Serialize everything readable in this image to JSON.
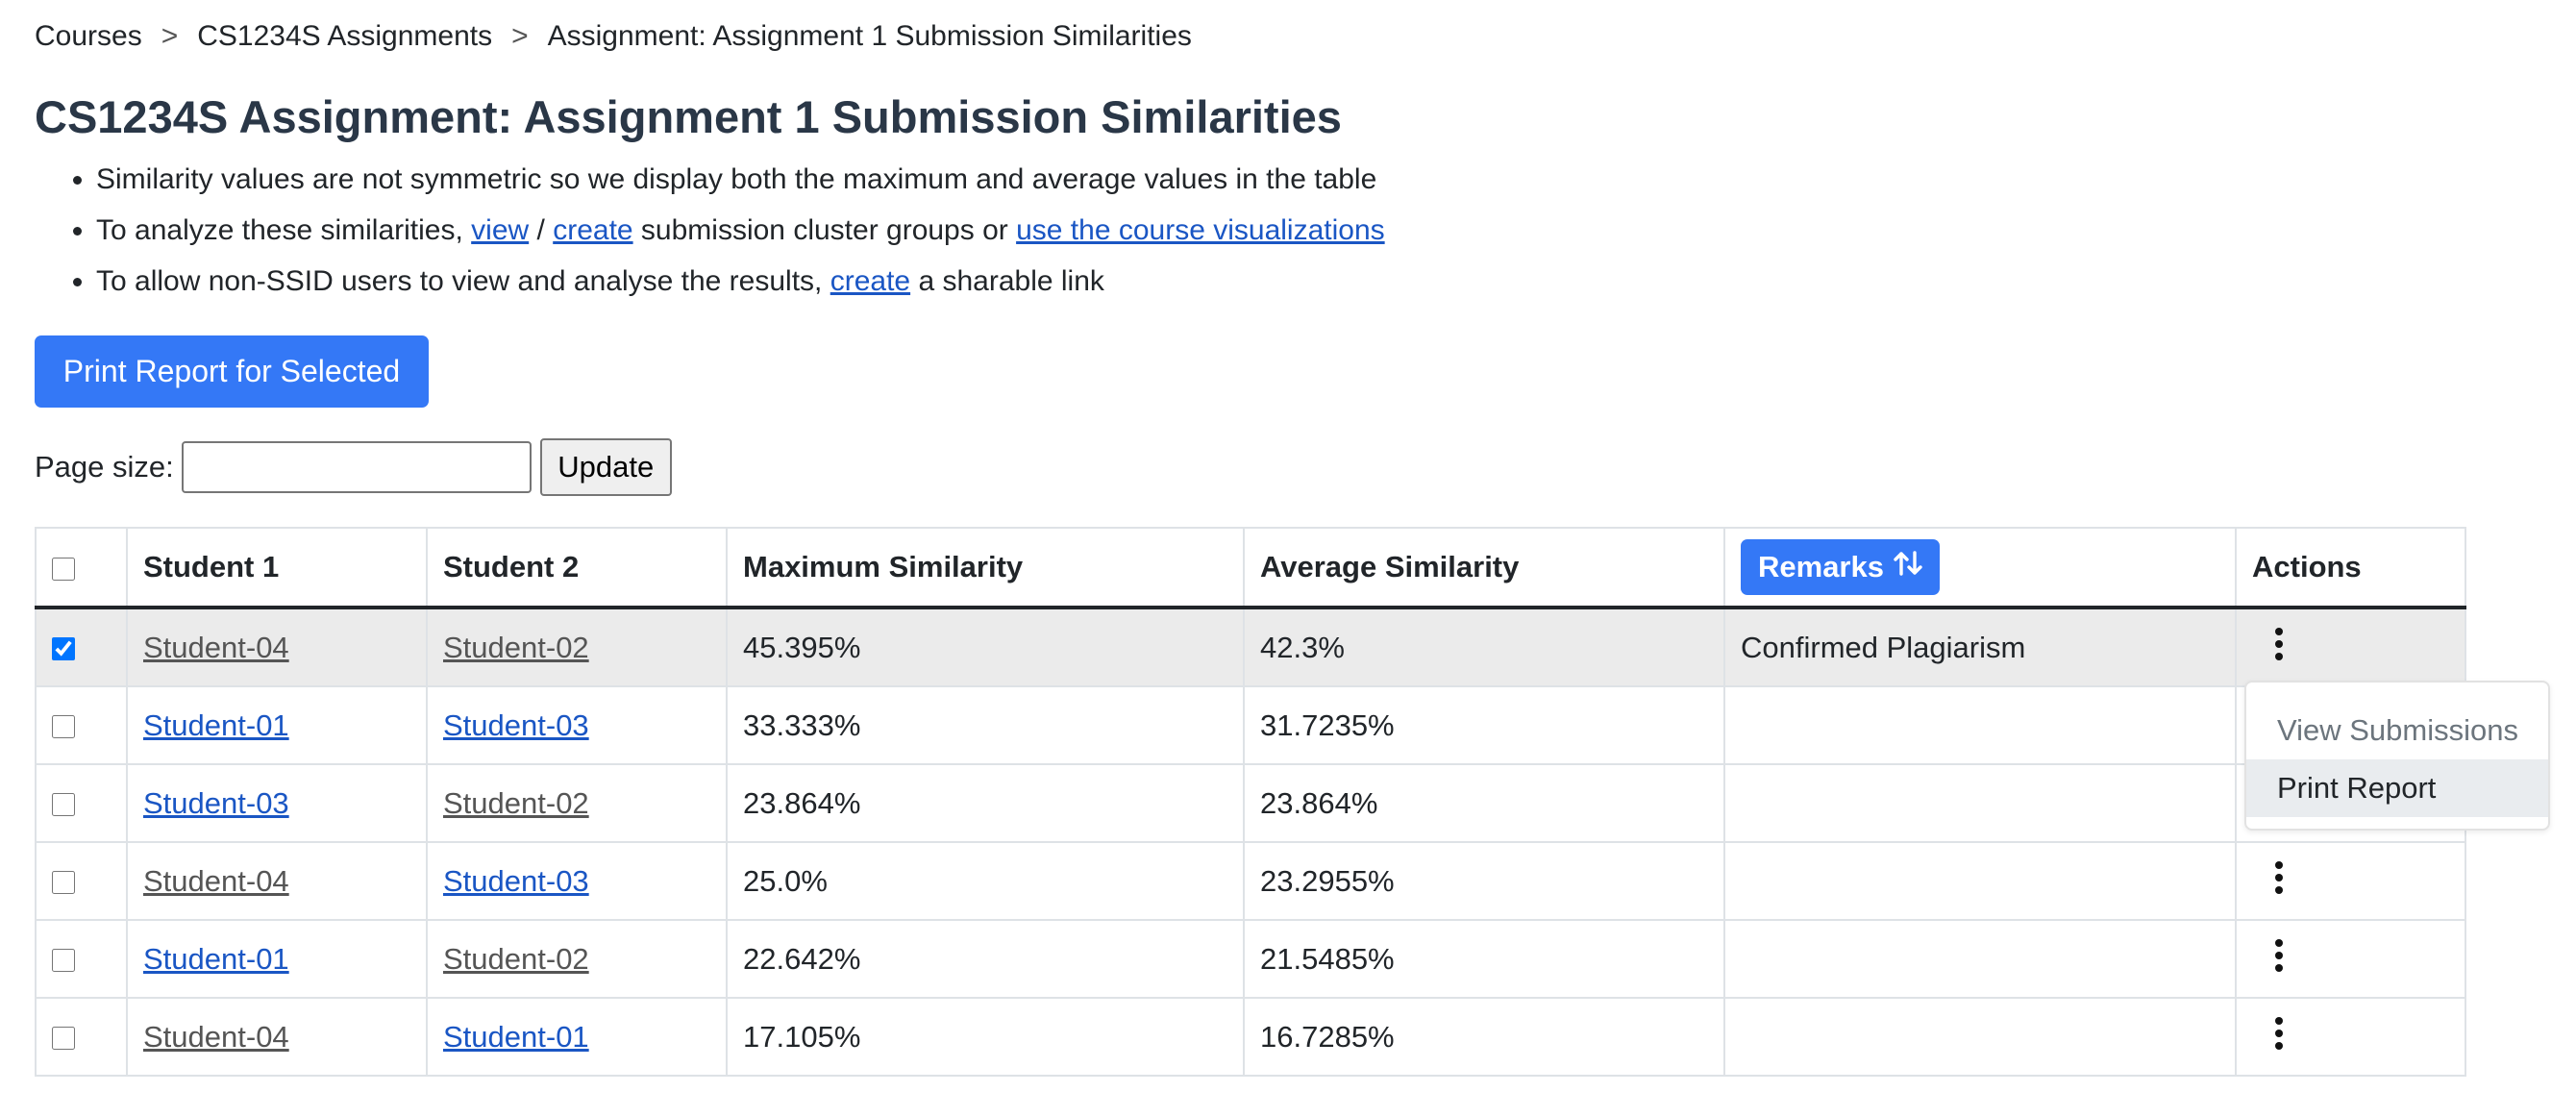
{
  "breadcrumb": {
    "items": [
      "Courses",
      "CS1234S Assignments",
      "Assignment: Assignment 1 Submission Similarities"
    ],
    "separator": ">"
  },
  "page_title": "CS1234S Assignment: Assignment 1 Submission Similarities",
  "notes": {
    "note1": "Similarity values are not symmetric so we display both the maximum and average values in the table",
    "note2_prefix": "To analyze these similarities, ",
    "note2_view": "view",
    "note2_slash": " / ",
    "note2_create": "create",
    "note2_middle": " submission cluster groups or ",
    "note2_visualizations": "use the course visualizations",
    "note3_prefix": "To allow non-SSID users to view and analyse the results, ",
    "note3_create": "create",
    "note3_suffix": " a sharable link"
  },
  "print_selected_label": "Print Report for Selected",
  "page_size": {
    "label": "Page size:",
    "value": "",
    "update_label": "Update"
  },
  "table": {
    "columns": {
      "student1": "Student 1",
      "student2": "Student 2",
      "max_similarity": "Maximum Similarity",
      "avg_similarity": "Average Similarity",
      "remarks": "Remarks",
      "actions": "Actions"
    },
    "rows": [
      {
        "checked": true,
        "student1": "Student-04",
        "student2": "Student-02",
        "max": "45.395%",
        "avg": "42.3%",
        "remarks": "Confirmed Plagiarism"
      },
      {
        "checked": false,
        "student1": "Student-01",
        "student2": "Student-03",
        "max": "33.333%",
        "avg": "31.7235%",
        "remarks": ""
      },
      {
        "checked": false,
        "student1": "Student-03",
        "student2": "Student-02",
        "max": "23.864%",
        "avg": "23.864%",
        "remarks": ""
      },
      {
        "checked": false,
        "student1": "Student-04",
        "student2": "Student-03",
        "max": "25.0%",
        "avg": "23.2955%",
        "remarks": ""
      },
      {
        "checked": false,
        "student1": "Student-01",
        "student2": "Student-02",
        "max": "22.642%",
        "avg": "21.5485%",
        "remarks": ""
      },
      {
        "checked": false,
        "student1": "Student-04",
        "student2": "Student-01",
        "max": "17.105%",
        "avg": "16.7285%",
        "remarks": ""
      }
    ]
  },
  "actions_menu": {
    "view_submissions": "View Submissions",
    "print_report": "Print Report"
  },
  "icons": {
    "sort": "sort-arrows-icon",
    "actions": "kebab-menu-icon"
  },
  "colors": {
    "primary": "#3478f6",
    "link": "#1a56c4",
    "visited_link": "#555555",
    "heading": "#2a3747",
    "selected_row": "#ebebeb"
  }
}
